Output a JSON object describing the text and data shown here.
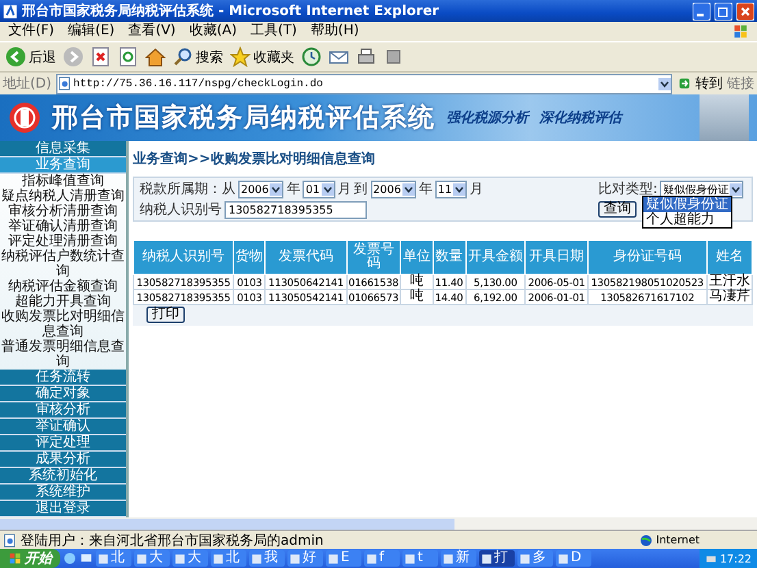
{
  "window": {
    "title": "邢台市国家税务局纳税评估系统 - Microsoft Internet Explorer"
  },
  "menu": [
    "文件(F)",
    "编辑(E)",
    "查看(V)",
    "收藏(A)",
    "工具(T)",
    "帮助(H)"
  ],
  "toolbar": {
    "back": "后退",
    "search": "搜索",
    "favorites": "收藏夹"
  },
  "address": {
    "label": "地址(D)",
    "url": "http://75.36.16.117/nspg/checkLogin.do",
    "go": "转到",
    "links": "链接"
  },
  "banner": {
    "title": "邢台市国家税务局纳税评估系统",
    "slogans": [
      "强化税源分析",
      "深化纳税评估"
    ]
  },
  "sidebar": {
    "sections": [
      {
        "label": "信息采集",
        "expanded": false
      },
      {
        "label": "业务查询",
        "expanded": true,
        "items": [
          "指标峰值查询",
          "疑点纳税人清册查询",
          "审核分析清册查询",
          "举证确认清册查询",
          "评定处理清册查询",
          "纳税评估户数统计查询",
          "纳税评估金额查询",
          "超能力开具查询",
          "收购发票比对明细信息查询",
          "普通发票明细信息查询"
        ]
      },
      {
        "label": "任务流转",
        "expanded": false
      },
      {
        "label": "确定对象",
        "expanded": false
      },
      {
        "label": "审核分析",
        "expanded": false
      },
      {
        "label": "举证确认",
        "expanded": false
      },
      {
        "label": "评定处理",
        "expanded": false
      },
      {
        "label": "成果分析",
        "expanded": false
      },
      {
        "label": "系统初始化",
        "expanded": false
      },
      {
        "label": "系统维护",
        "expanded": false
      },
      {
        "label": "退出登录",
        "expanded": false
      }
    ]
  },
  "breadcrumb": "业务查询>>收购发票比对明细信息查询",
  "form": {
    "period": [
      {
        "kind": "text",
        "text": "税款所属期：从"
      },
      {
        "kind": "select",
        "value": "2006"
      },
      {
        "kind": "text",
        "text": "年"
      },
      {
        "kind": "select",
        "value": "01"
      },
      {
        "kind": "text",
        "text": "月"
      },
      {
        "kind": "text",
        "text": "到"
      },
      {
        "kind": "select",
        "value": "2006"
      },
      {
        "kind": "text",
        "text": "年"
      },
      {
        "kind": "select",
        "value": "11"
      },
      {
        "kind": "text",
        "text": "月"
      }
    ],
    "compare": {
      "label": "比对类型:",
      "value": "疑似假身份证",
      "options": [
        {
          "label": "疑似假身份证",
          "selected": true
        },
        {
          "label": "个人超能力",
          "selected": false
        }
      ]
    },
    "taxpayer": {
      "label": "纳税人识别号",
      "value": "130582718395355"
    },
    "query_button": "查询"
  },
  "table": {
    "columns": [
      "纳税人识别号",
      "货物",
      "发票代码",
      "发票号码",
      "单位",
      "数量",
      "开具金额",
      "开具日期",
      "身份证号码",
      "姓名"
    ],
    "rows": [
      [
        "130582718395355",
        "0103",
        "113050642141",
        "01661538",
        "吨",
        "11.40",
        "5,130.00",
        "2006-05-01",
        "130582198051020523",
        "王汗水"
      ],
      [
        "130582718395355",
        "0103",
        "113050542141",
        "01066573",
        "吨",
        "14.40",
        "6,192.00",
        "2006-01-01",
        "130582671617102",
        "马凄芹"
      ]
    ]
  },
  "print_button": "打印",
  "status_bar": {
    "text": "登陆用户：来自河北省邢台市国家税务局的admin",
    "zone": "Internet"
  },
  "taskbar": {
    "start": "开始",
    "tasks": [
      {
        "label": "北",
        "selected": false
      },
      {
        "label": "大",
        "selected": false
      },
      {
        "label": "大",
        "selected": false
      },
      {
        "label": "北",
        "selected": false
      },
      {
        "label": "我",
        "selected": false
      },
      {
        "label": "好",
        "selected": false
      },
      {
        "label": "E",
        "selected": false
      },
      {
        "label": "f",
        "selected": false
      },
      {
        "label": "t",
        "selected": false
      },
      {
        "label": "新",
        "selected": false
      },
      {
        "label": "打",
        "selected": true
      },
      {
        "label": "多",
        "selected": false
      },
      {
        "label": "D",
        "selected": false
      }
    ],
    "clock": "17:22"
  }
}
